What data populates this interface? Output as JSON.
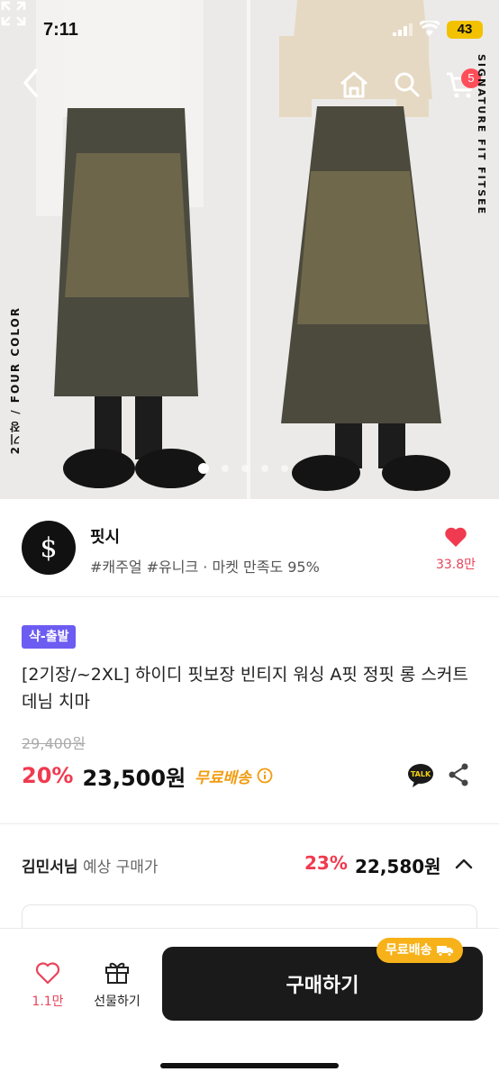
{
  "status_bar": {
    "time": "7:11",
    "battery": "43"
  },
  "header": {
    "cart_count": "5"
  },
  "hero": {
    "side_text_left": "2기장 / FOUR COLOR",
    "side_text_right": "SIGNATURE FIT FITSEE",
    "dots_total": 5,
    "active_dot": 1,
    "icons": [
      "back-arrow-icon",
      "home-icon",
      "search-icon",
      "cart-icon",
      "expand-icon"
    ]
  },
  "seller": {
    "logo": "$",
    "name": "핏시",
    "tags": "#캐주얼 #유니크 · 마켓 만족도 95%",
    "like_count": "33.8만"
  },
  "product": {
    "badge": "샥-출발",
    "title": "[2기장/~2XL] 하이디 핏보장 빈티지 워싱 A핏 정핏 롱 스커트 데님 치마",
    "original_price": "29,400원",
    "discount": "20%",
    "price": "23,500원",
    "free_shipping": "무료배송",
    "talk_label": "TALK"
  },
  "expected": {
    "user": "김민서님",
    "label": "예상 구매가",
    "rate": "23%",
    "price": "22,580원"
  },
  "bottom_bar": {
    "like_count": "1.1만",
    "gift_label": "선물하기",
    "buy_label": "구매하기",
    "ship_pill": "무료배송"
  },
  "colors": {
    "accent_red": "#f03a4f",
    "badge_purple": "#6d5cf2",
    "ship_orange": "#f7b21a",
    "buy_button": "#1a1a1a"
  }
}
